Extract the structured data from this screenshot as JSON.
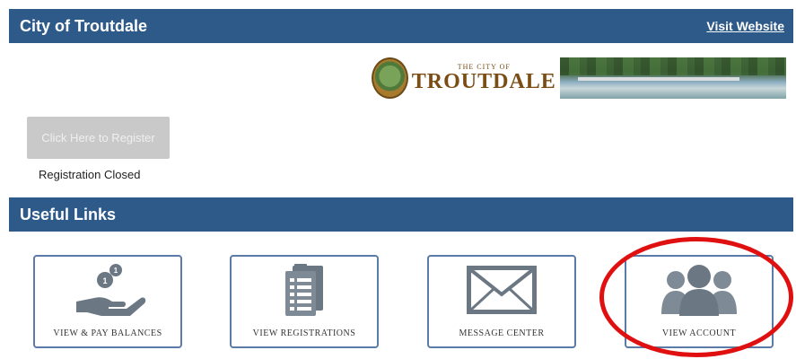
{
  "header": {
    "title": "City of Troutdale",
    "visit_link": "Visit Website"
  },
  "banner": {
    "logo_small": "THE CITY OF",
    "logo_big": "TROUTDALE"
  },
  "registration": {
    "button_label": "Click Here to Register",
    "status": "Registration Closed"
  },
  "useful_links": {
    "title": "Useful Links",
    "tiles": [
      {
        "label": "VIEW & PAY BALANCES",
        "icon": "hand-coins-icon"
      },
      {
        "label": "VIEW REGISTRATIONS",
        "icon": "clipboard-list-icon"
      },
      {
        "label": "MESSAGE CENTER",
        "icon": "envelope-icon"
      },
      {
        "label": "VIEW ACCOUNT",
        "icon": "users-icon"
      }
    ]
  },
  "colors": {
    "header_bar": "#2e5a8a",
    "tile_border": "#5a7aa8",
    "icon_gray": "#6b7884",
    "highlight": "#e01010"
  }
}
